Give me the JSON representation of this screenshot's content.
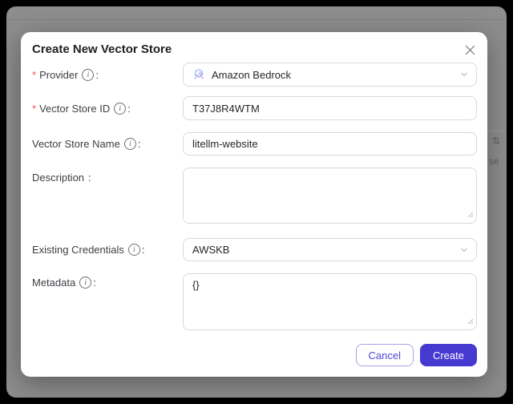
{
  "backdrop": {
    "sort_icon": "⇅",
    "partial_text": "se"
  },
  "modal": {
    "title": "Create New Vector Store",
    "colon": ":",
    "required_mark": "*",
    "info_glyph": "i",
    "fields": {
      "provider": {
        "label": "Provider",
        "value": "Amazon Bedrock"
      },
      "vector_store_id": {
        "label": "Vector Store ID",
        "value": "T37J8R4WTM"
      },
      "vector_store_name": {
        "label": "Vector Store Name",
        "value": "litellm-website"
      },
      "description": {
        "label": "Description",
        "value": ""
      },
      "existing_credentials": {
        "label": "Existing Credentials",
        "value": "AWSKB"
      },
      "metadata": {
        "label": "Metadata",
        "value": "{}"
      }
    },
    "footer": {
      "cancel_label": "Cancel",
      "create_label": "Create"
    }
  },
  "colors": {
    "accent": "#4639cf",
    "cancel_text": "#4f46d6",
    "cancel_border": "#a9a2f0",
    "required": "#ff4d4f",
    "backdrop": "#8d8d8d"
  }
}
